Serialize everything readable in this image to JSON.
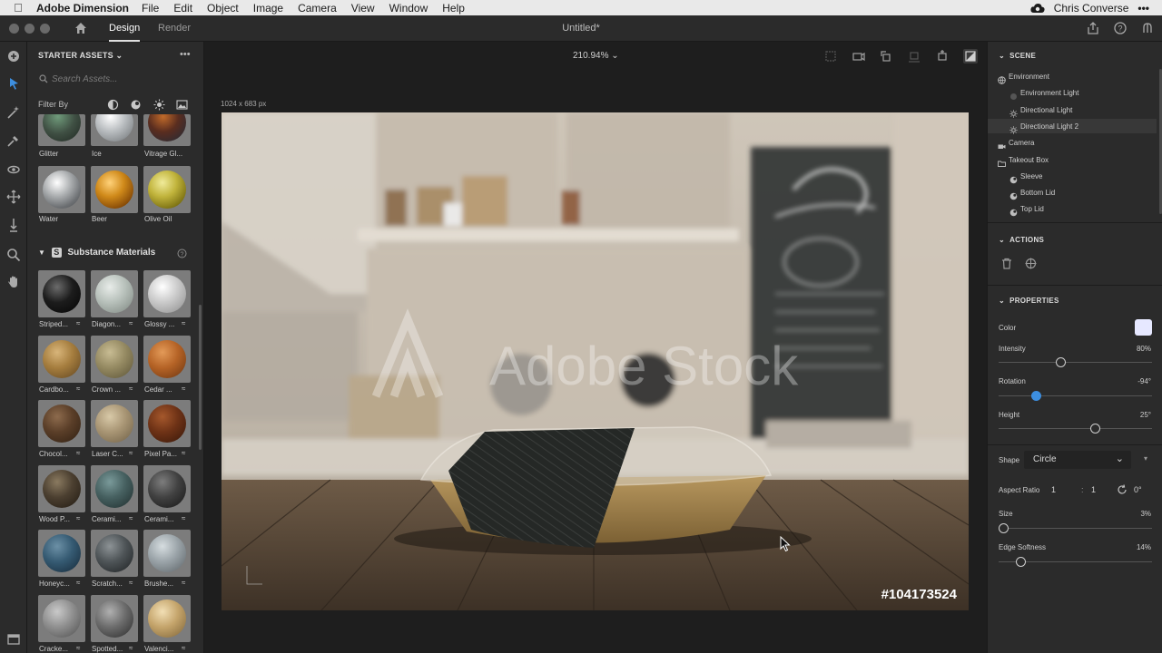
{
  "menubar": {
    "app_name": "Adobe Dimension",
    "menus": [
      "File",
      "Edit",
      "Object",
      "Image",
      "Camera",
      "View",
      "Window",
      "Help"
    ],
    "user": "Chris Converse"
  },
  "titlebar": {
    "tabs": [
      "Design",
      "Render"
    ],
    "active_tab": "Design",
    "doc_title": "Untitled*"
  },
  "assets": {
    "header": "STARTER ASSETS",
    "search_placeholder": "Search Assets...",
    "filter_label": "Filter By",
    "top_row": [
      "Glitter",
      "Ice",
      "Vitrage Gl..."
    ],
    "row2": [
      "Water",
      "Beer",
      "Olive Oil"
    ],
    "substance_header": "Substance Materials",
    "substance": [
      [
        "Striped...",
        "Diagon...",
        "Glossy ..."
      ],
      [
        "Cardbo...",
        "Crown ...",
        "Cedar ..."
      ],
      [
        "Chocol...",
        "Laser C...",
        "Pixel Pa..."
      ],
      [
        "Wood P...",
        "Cerami...",
        "Cerami..."
      ],
      [
        "Honeyc...",
        "Scratch...",
        "Brushe..."
      ],
      [
        "Cracke...",
        "Spotted...",
        "Valenci..."
      ]
    ]
  },
  "canvas": {
    "zoom": "210.94%",
    "dimensions": "1024 x 683 px",
    "watermark": "Adobe Stock",
    "stock_id": "#104173524"
  },
  "scene": {
    "header": "SCENE",
    "items": [
      {
        "label": "Environment",
        "level": 0
      },
      {
        "label": "Environment Light",
        "level": 1
      },
      {
        "label": "Directional Light",
        "level": 1
      },
      {
        "label": "Directional Light 2",
        "level": 1
      },
      {
        "label": "Camera",
        "level": 0
      },
      {
        "label": "Takeout Box",
        "level": 0
      },
      {
        "label": "Sleeve",
        "level": 1
      },
      {
        "label": "Bottom Lid",
        "level": 1
      },
      {
        "label": "Top Lid",
        "level": 1
      }
    ]
  },
  "actions": {
    "header": "ACTIONS"
  },
  "properties": {
    "header": "PROPERTIES",
    "color_label": "Color",
    "intensity_label": "Intensity",
    "intensity_value": "80%",
    "intensity_level": 0.4,
    "rotation_label": "Rotation",
    "rotation_value": "-94°",
    "rotation_level": 0.24,
    "height_label": "Height",
    "height_value": "25°",
    "height_level": 0.63,
    "shape_label": "Shape",
    "shape_value": "Circle",
    "aspect_label": "Aspect Ratio",
    "aspect_w": "1",
    "aspect_sep": ":",
    "aspect_h": "1",
    "aspect_angle": "0°",
    "size_label": "Size",
    "size_value": "3%",
    "size_level": 0.03,
    "softness_label": "Edge Softness",
    "softness_value": "14%",
    "softness_level": 0.14
  },
  "colors": {
    "accent": "#3d8fe0",
    "panel": "#2b2b2b",
    "canvas": "#1e1e1e",
    "light_color": "#e6e8ff"
  }
}
